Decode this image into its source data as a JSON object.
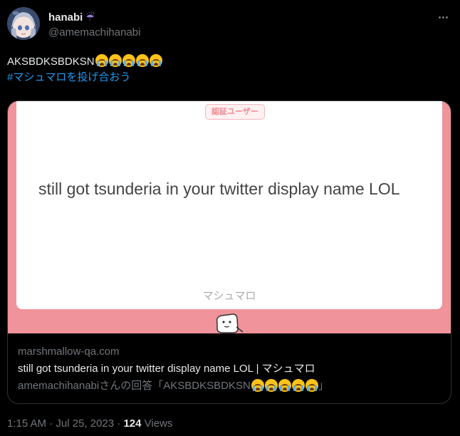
{
  "user": {
    "display_name": "hanabi",
    "handle": "@amemachihanabi"
  },
  "icons": {
    "umbrella": "☔",
    "more": "more-dots-icon",
    "avatar": "avatar-anime-girl",
    "cry": "loudly-crying-face-emoji"
  },
  "tweet": {
    "text": "AKSBDKSBDKSN",
    "emoji_count": 5,
    "hashtag": "#マシュマロを投げ合おう"
  },
  "card": {
    "badge": "認証ユーザー",
    "question": "still got tsunderia in your twitter display name LOL",
    "brand": "マシュマロ",
    "domain": "marshmallow-qa.com",
    "title": "still got tsunderia in your twitter display name LOL | マシュマロ",
    "desc_prefix": "amemachihanabiさんの回答「AKSBDKSBDKSN",
    "desc_suffix": "」"
  },
  "meta": {
    "time": "1:15 AM",
    "date": "Jul 25, 2023",
    "separator": " · ",
    "views_count": "124",
    "views_label": " Views"
  },
  "colors": {
    "background": "#000000",
    "text": "#e7e9ea",
    "muted": "#71767b",
    "link": "#1d9bf0",
    "card_pink": "#f0939a"
  }
}
